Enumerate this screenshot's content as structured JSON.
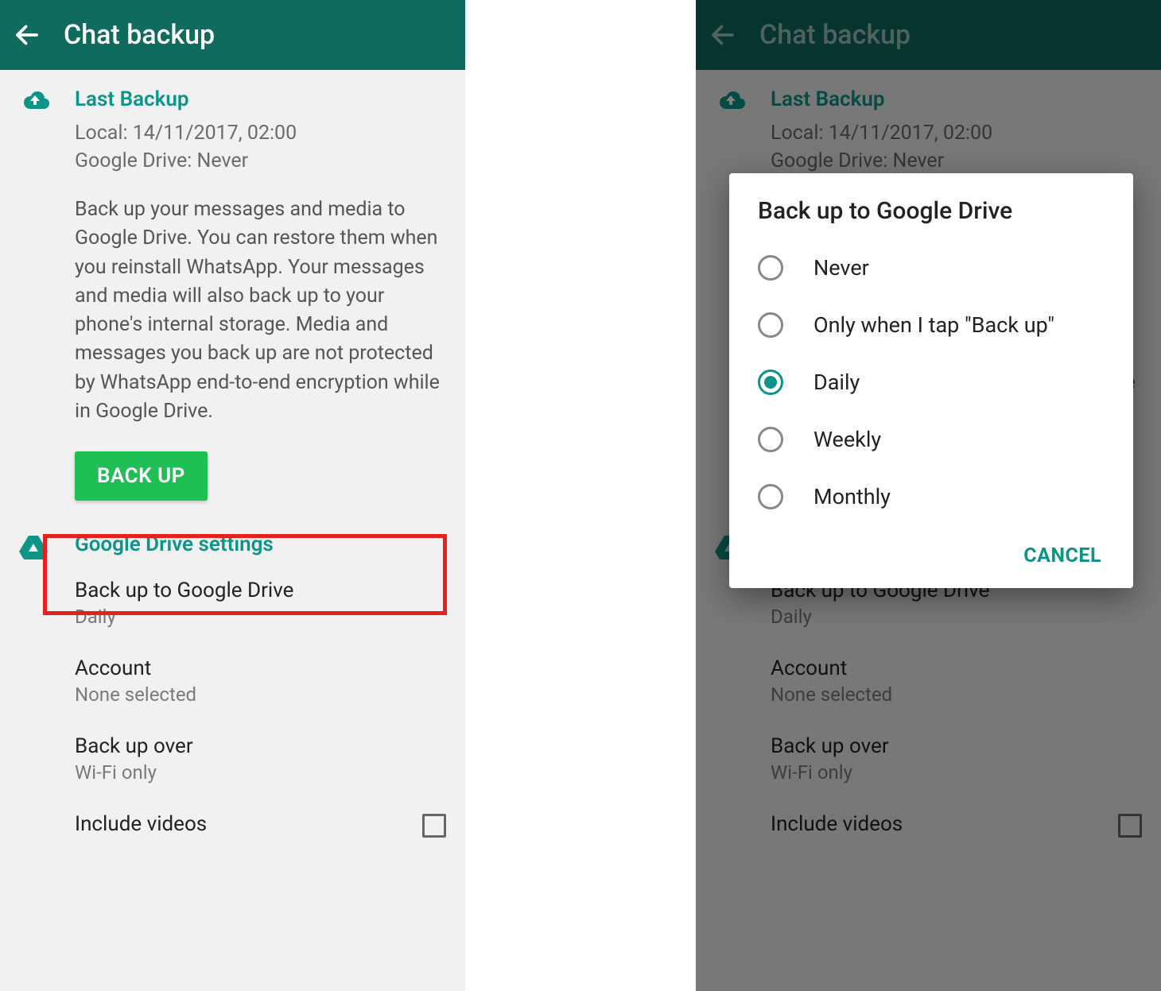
{
  "appbar": {
    "title": "Chat backup"
  },
  "lastBackup": {
    "heading": "Last Backup",
    "local": "Local: 14/11/2017, 02:00",
    "gdrive": "Google Drive: Never",
    "description": "Back up your messages and media to Google Drive. You can restore them when you reinstall WhatsApp. Your messages and media will also back up to your phone's internal storage. Media and messages you back up are not protected by WhatsApp end-to-end encryption while in Google Drive.",
    "button": "BACK UP"
  },
  "gdriveSettings": {
    "heading": "Google Drive settings",
    "items": [
      {
        "title": "Back up to Google Drive",
        "sub": "Daily"
      },
      {
        "title": "Account",
        "sub": "None selected"
      },
      {
        "title": "Back up over",
        "sub": "Wi-Fi only"
      },
      {
        "title": "Include videos"
      }
    ]
  },
  "dialog": {
    "title": "Back up to Google Drive",
    "options": [
      "Never",
      "Only when I tap \"Back up\"",
      "Daily",
      "Weekly",
      "Monthly"
    ],
    "selectedIndex": 2,
    "cancel": "CANCEL"
  }
}
